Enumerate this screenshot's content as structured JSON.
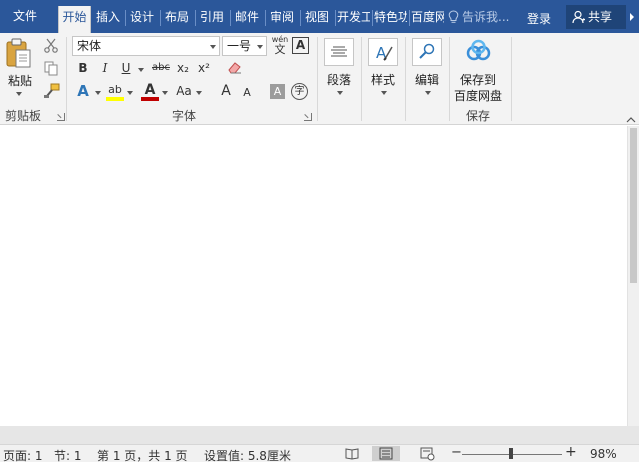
{
  "tabs": {
    "file": "文件",
    "items": [
      "开始",
      "插入",
      "设计",
      "布局",
      "引用",
      "邮件",
      "审阅",
      "视图",
      "开发工",
      "特色功",
      "百度网"
    ],
    "active_index": 0,
    "tell_me": "告诉我...",
    "login": "登录",
    "share": "共享"
  },
  "clipboard": {
    "paste_label": "粘贴",
    "group_label": "剪贴板",
    "cut_icon": "scissors-icon",
    "copy_icon": "copy-icon",
    "format_painter_icon": "paintbrush-icon"
  },
  "font": {
    "font_name": "宋体",
    "font_size": "一号",
    "phonetic_top": "wén",
    "phonetic_bottom": "文",
    "char_border": "A",
    "bold": "B",
    "italic": "I",
    "underline": "U",
    "strikethrough": "abc",
    "subscript": "x₂",
    "superscript": "x²",
    "text_effects": "A",
    "highlight": "ab",
    "font_color": "A",
    "change_case": "Aa",
    "grow": "A",
    "shrink": "A",
    "char_shading": "A",
    "enclose": "字",
    "group_label": "字体"
  },
  "paragraph": {
    "label": "段落"
  },
  "styles": {
    "label": "样式"
  },
  "editing": {
    "label": "编辑"
  },
  "save": {
    "label_line1": "保存到",
    "label_line2": "百度网盘",
    "group_label": "保存"
  },
  "status": {
    "page": "页面: 1",
    "section": "节: 1",
    "page_count": "第 1 页，共 1 页",
    "setting": "设置值: 5.8厘米",
    "zoom": "98%",
    "zoom_level": 0.98
  },
  "colors": {
    "tabbar": "#2b579a",
    "ribbon": "#f3f3f3",
    "font_color_bar": "#c00000",
    "highlight_bar": "#ffff00",
    "text_effect": "#2e75b6"
  }
}
